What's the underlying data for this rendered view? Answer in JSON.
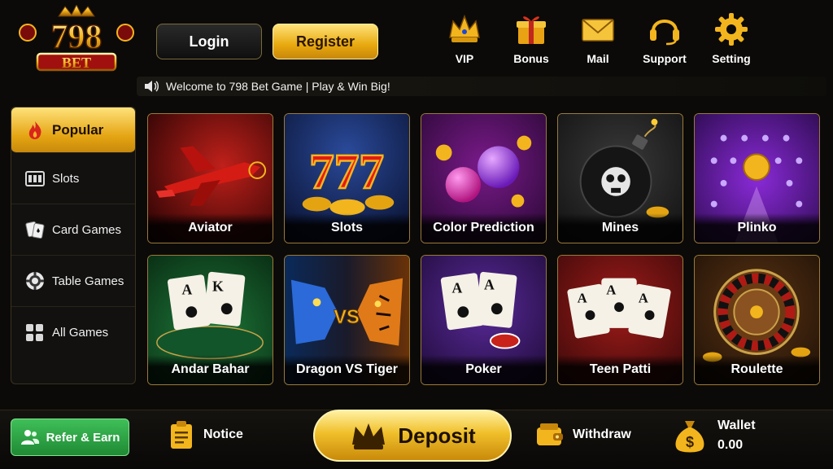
{
  "logo": {
    "top_text": "798",
    "bottom_text": "BET"
  },
  "auth": {
    "login_label": "Login",
    "register_label": "Register"
  },
  "top_nav": [
    {
      "label": "VIP",
      "icon": "crown-icon"
    },
    {
      "label": "Bonus",
      "icon": "gift-icon"
    },
    {
      "label": "Mail",
      "icon": "mail-icon"
    },
    {
      "label": "Support",
      "icon": "headset-icon"
    },
    {
      "label": "Setting",
      "icon": "gear-icon"
    }
  ],
  "marquee": {
    "text": "Welcome to 798 Bet Game | Play & Win Big!",
    "icon": "speaker-icon"
  },
  "sidebar": {
    "items": [
      {
        "label": "Popular",
        "icon": "fire-icon",
        "active": true
      },
      {
        "label": "Slots",
        "icon": "slot-machine-icon",
        "active": false
      },
      {
        "label": "Card Games",
        "icon": "playing-cards-icon",
        "active": false
      },
      {
        "label": "Table Games",
        "icon": "poker-chip-icon",
        "active": false
      },
      {
        "label": "All Games",
        "icon": "grid-icon",
        "active": false
      }
    ]
  },
  "games": [
    {
      "label": "Aviator",
      "icon": "airplane-icon"
    },
    {
      "label": "Slots",
      "icon": "777-slots-icon",
      "art_text": "777"
    },
    {
      "label": "Color Prediction",
      "icon": "color-balls-icon"
    },
    {
      "label": "Mines",
      "icon": "bomb-icon"
    },
    {
      "label": "Plinko",
      "icon": "plinko-icon"
    },
    {
      "label": "Andar Bahar",
      "icon": "andar-bahar-cards-icon",
      "art_text": [
        "A",
        "K"
      ]
    },
    {
      "label": "Dragon VS Tiger",
      "icon": "dragon-tiger-icon",
      "art_text": "VS"
    },
    {
      "label": "Poker",
      "icon": "poker-cards-icon",
      "art_text": [
        "A",
        "A"
      ]
    },
    {
      "label": "Teen Patti",
      "icon": "teen-patti-cards-icon",
      "art_text": [
        "A",
        "A",
        "A"
      ]
    },
    {
      "label": "Roulette",
      "icon": "roulette-wheel-icon"
    }
  ],
  "bottom": {
    "refer_label": "Refer & Earn",
    "notice_label": "Notice",
    "deposit_label": "Deposit",
    "withdraw_label": "Withdraw",
    "wallet_label": "Wallet",
    "wallet_balance": "0.00"
  },
  "colors": {
    "gold": "#f0bf2a",
    "green": "#2fa446",
    "background": "#0b0a08"
  }
}
